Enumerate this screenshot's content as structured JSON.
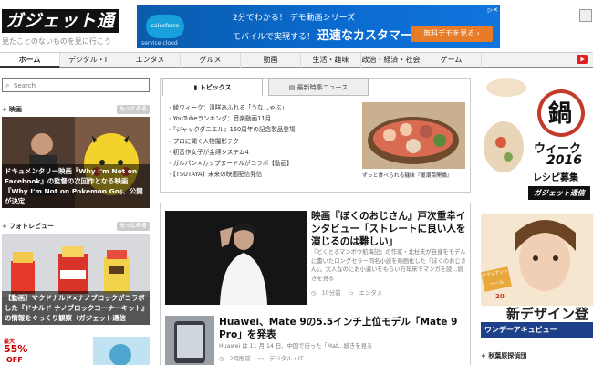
{
  "header": {
    "logo_text": "ガジェット通信",
    "tagline": "見たことのないものを見に行こう"
  },
  "banner": {
    "brand": "salesforce",
    "brand_sub": "service cloud",
    "line1": "2分でわかる！ デモ動画シリーズ",
    "line2_prefix": "モバイルで実現する！",
    "line2_emph": "迅速なカスタマーサポート",
    "cta": "無料デモを見る ›",
    "ad_mark": "▷✕"
  },
  "nav": {
    "items": [
      "ホーム",
      "デジタル・IT",
      "エンタメ",
      "グルメ",
      "動画",
      "生活・趣味",
      "政治・経済・社会",
      "ゲーム"
    ],
    "active_index": 0
  },
  "search": {
    "placeholder": "Search"
  },
  "sections": {
    "movie": {
      "label": "映画",
      "more": "もっとみる"
    },
    "photo": {
      "label": "フォトレビュー",
      "more": "もっとみる"
    }
  },
  "features": {
    "movie_caption": "ドキュメンタリー映画『Why I'm Not on Facebook』の監督の次回作となる映画『Why I'm Not on Pokemon Go』、公開が決定",
    "photo_caption": "【動画】マクドナルド×ナノブロックがコラボした『ドナルド ナノブロックコーナーキット』の情報をぐっくり観察（ガジェット通信"
  },
  "tabs": {
    "topics": "トピックス",
    "news": "最新時事ニュース"
  },
  "topics": [
    "綾ウィーク：沮咩あふれる「うなしゃぶ」",
    "YouTubeランキング：音楽動画11月",
    "『ジャックダニエル』150周年の記念製品登場",
    "プロに聞く人物撮影テク",
    "初音作女子が金缚システム4",
    "ガルパン×カップヌードルがコラボ【動画】",
    "【TSUTAYA】未来の映画配信発信"
  ],
  "topic_thumb_caption": "ずっと食べられる麺味『暖潮菜開橋』",
  "articles": [
    {
      "title": "映画『ぼくのおじさん』戸次重幸インタビュー「ストレートに良い人を演じるのは難しい」",
      "body": "『どくとるマンボウ航海記』の作家・北杜夫が自身をモデルに書いたロングセラー同名小説を映画化した『ぼくのおじさん』。大人なのにお小遣いをもらい万年床でマンガを読…続きを見る",
      "time": "10分前",
      "category": "エンタメ"
    },
    {
      "title": "Huawei、Mate 9の5.5インチ上位モデル「Mate 9 Pro」を発表",
      "body": "Huawei は 11 月 14 日、中国で行った「Mat…続きを見る",
      "time": "2時間前",
      "category": "デジタル・IT"
    }
  ],
  "ad1": {
    "kanji": "鍋",
    "title": "ウィーク",
    "year": "2016",
    "sub": "レシピ募集",
    "brand": "ガジェット通信"
  },
  "ad2": {
    "headline": "新デザイン登",
    "year": "20",
    "brand": "ワンデーアキュビュー",
    "tag": "ラディアント ベール"
  },
  "right_foot": {
    "label": "秋葉原探偵団"
  },
  "left_foot_ad": {
    "line1": "最大",
    "line2": "55%",
    "line3": "OFF"
  },
  "colors": {
    "banner_blue": "#0b5cab",
    "cta_orange": "#e87b27",
    "youtube_red": "#e02020"
  }
}
